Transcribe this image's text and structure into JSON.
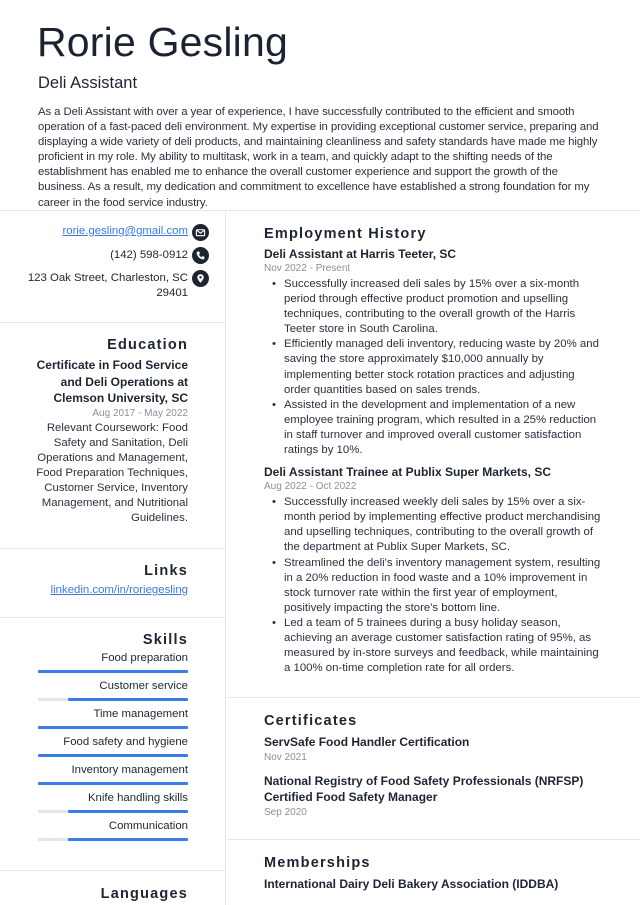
{
  "header": {
    "name": "Rorie Gesling",
    "title": "Deli Assistant",
    "summary": "As a Deli Assistant with over a year of experience, I have successfully contributed to the efficient and smooth operation of a fast-paced deli environment. My expertise in providing exceptional customer service, preparing and displaying a wide variety of deli products, and maintaining cleanliness and safety standards have made me highly proficient in my role. My ability to multitask, work in a team, and quickly adapt to the shifting needs of the establishment has enabled me to enhance the overall customer experience and support the growth of the business. As a result, my dedication and commitment to excellence have established a strong foundation for my career in the food service industry."
  },
  "contact": {
    "email": "rorie.gesling@gmail.com",
    "phone": "(142) 598-0912",
    "address_line1": "123 Oak Street, Charleston, SC",
    "address_line2": "29401",
    "icons": [
      "envelope-icon",
      "phone-icon",
      "location-pin-icon"
    ]
  },
  "education": {
    "title": "Education",
    "degree": "Certificate in Food Service and Deli Operations at Clemson University, SC",
    "dates": "Aug 2017 - May 2022",
    "description": "Relevant Coursework: Food Safety and Sanitation, Deli Operations and Management, Food Preparation Techniques, Customer Service, Inventory Management, and Nutritional Guidelines."
  },
  "links": {
    "title": "Links",
    "items": [
      "linkedin.com/in/roriegesling"
    ]
  },
  "skills": {
    "title": "Skills",
    "accent_color": "#3b7de6",
    "items": [
      {
        "label": "Food preparation",
        "level": 1.0
      },
      {
        "label": "Customer service",
        "level": 0.8
      },
      {
        "label": "Time management",
        "level": 1.0
      },
      {
        "label": "Food safety and hygiene",
        "level": 1.0
      },
      {
        "label": "Inventory management",
        "level": 1.0
      },
      {
        "label": "Knife handling skills",
        "level": 0.8
      },
      {
        "label": "Communication",
        "level": 0.8
      }
    ]
  },
  "languages": {
    "title": "Languages"
  },
  "employment": {
    "title": "Employment History",
    "jobs": [
      {
        "title": "Deli Assistant at Harris Teeter, SC",
        "dates": "Nov 2022 - Present",
        "bullets": [
          "Successfully increased deli sales by 15% over a six-month period through effective product promotion and upselling techniques, contributing to the overall growth of the Harris Teeter store in South Carolina.",
          "Efficiently managed deli inventory, reducing waste by 20% and saving the store approximately $10,000 annually by implementing better stock rotation practices and adjusting order quantities based on sales trends.",
          "Assisted in the development and implementation of a new employee training program, which resulted in a 25% reduction in staff turnover and improved overall customer satisfaction ratings by 10%."
        ]
      },
      {
        "title": "Deli Assistant Trainee at Publix Super Markets, SC",
        "dates": "Aug 2022 - Oct 2022",
        "bullets": [
          "Successfully increased weekly deli sales by 15% over a six-month period by implementing effective product merchandising and upselling techniques, contributing to the overall growth of the department at Publix Super Markets, SC.",
          "Streamlined the deli's inventory management system, resulting in a 20% reduction in food waste and a 10% improvement in stock turnover rate within the first year of employment, positively impacting the store's bottom line.",
          "Led a team of 5 trainees during a busy holiday season, achieving an average customer satisfaction rating of 95%, as measured by in-store surveys and feedback, while maintaining a 100% on-time completion rate for all orders."
        ]
      }
    ]
  },
  "certificates": {
    "title": "Certificates",
    "items": [
      {
        "name": "ServSafe Food Handler Certification",
        "date": "Nov 2021"
      },
      {
        "name": "National Registry of Food Safety Professionals (NRFSP) Certified Food Safety Manager",
        "date": "Sep 2020"
      }
    ]
  },
  "memberships": {
    "title": "Memberships",
    "items": [
      "International Dairy Deli Bakery Association (IDDBA)"
    ]
  }
}
